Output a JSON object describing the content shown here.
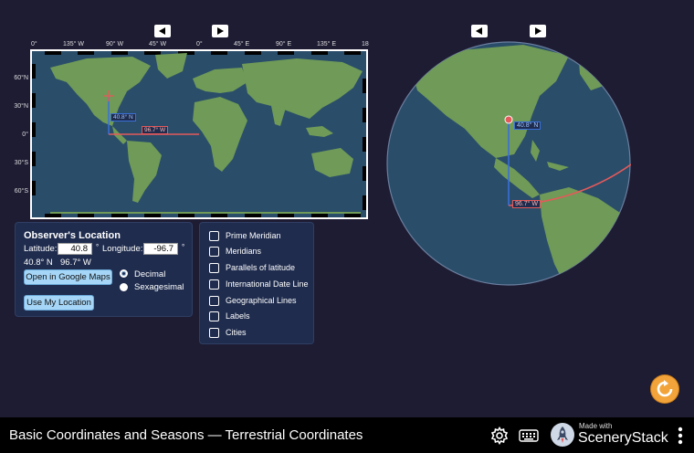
{
  "map": {
    "longitude_ticks": [
      "0°",
      "135° W",
      "90° W",
      "45° W",
      "0°",
      "45° E",
      "90° E",
      "135° E",
      "18"
    ],
    "latitude_ticks": [
      "60°N",
      "30°N",
      "0°",
      "30°S",
      "60°S"
    ],
    "lat_label": "40.8° N",
    "lon_label": "96.7° W"
  },
  "globe": {
    "lat_label": "40.8° N",
    "lon_label": "96.7° W"
  },
  "observer": {
    "title": "Observer's Location",
    "latitude_label": "Latitude:",
    "latitude_value": "40.8",
    "longitude_label": "Longitude:",
    "longitude_value": "-96.7",
    "degree_symbol": "°",
    "readout_lat": "40.8° N",
    "readout_lon": "96.7° W",
    "google_maps_button": "Open in Google Maps",
    "use_location_button": "Use My Location",
    "format_options": [
      "Decimal",
      "Sexagesimal"
    ],
    "selected_format": "Decimal"
  },
  "layers": {
    "items": [
      "Prime Meridian",
      "Meridians",
      "Parallels of latitude",
      "International Date Line",
      "Geographical Lines",
      "Labels",
      "Cities"
    ]
  },
  "footer": {
    "title": "Basic Coordinates and Seasons — Terrestrial Coordinates",
    "made_with": "Made with",
    "brand": "SceneryStack"
  },
  "colors": {
    "background": "#1e1c33",
    "ocean": "#2a4d6a",
    "land": "#6f9a57",
    "latitude_line": "#3a6fd8",
    "longitude_line": "#e45a5a",
    "reset": "#f2a43a"
  }
}
